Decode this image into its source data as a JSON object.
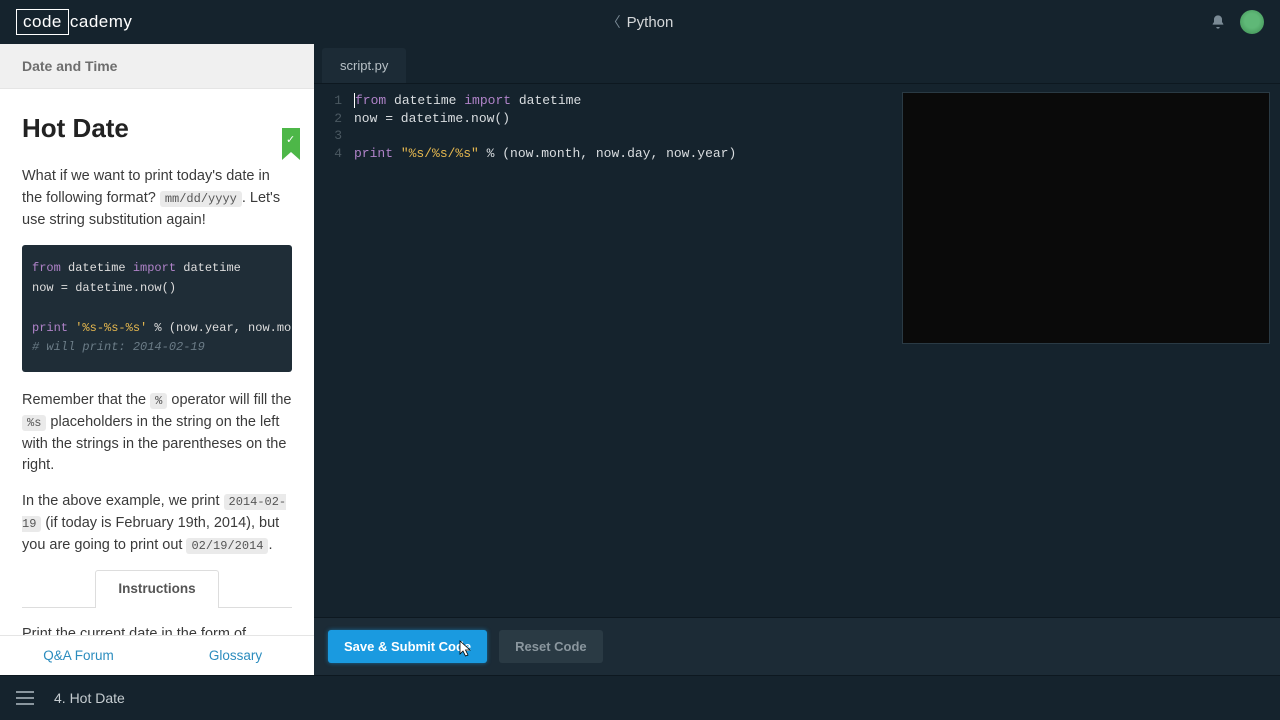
{
  "header": {
    "logo_box": "code",
    "logo_rest": "cademy",
    "course": "Python"
  },
  "lesson": {
    "section": "Date and Time",
    "title": "Hot Date",
    "p1_a": "What if we want to print today's date in the following format? ",
    "p1_code": "mm/dd/yyyy",
    "p1_b": ". Let's use string substitution again!",
    "example_code": {
      "l1_kw1": "from",
      "l1_t1": " datetime ",
      "l1_kw2": "import",
      "l1_t2": " datetime",
      "l2": "now = datetime.now()",
      "l3_kw": "print",
      "l3_str": " '%s-%s-%s'",
      "l3_t": " % (now.year, now.month, no",
      "l4": "# will print: 2014-02-19"
    },
    "p2_a": "Remember that the ",
    "p2_code1": "%",
    "p2_b": " operator will fill the ",
    "p2_code2": "%s",
    "p2_c": " placeholders in the string on the left with the strings in the parentheses on the right.",
    "p3_a": "In the above example, we print ",
    "p3_code1": "2014-02-19",
    "p3_b": " (if today is February 19th, 2014), but you are going to print out ",
    "p3_code2": "02/19/2014",
    "p3_c": ".",
    "instructions_label": "Instructions",
    "instructions_p1": "Print the current date in the form of",
    "footer_qa": "Q&A Forum",
    "footer_glossary": "Glossary"
  },
  "editor": {
    "tab": "script.py",
    "lines": [
      {
        "n": "1",
        "pre_kw": "from",
        "t1": " datetime ",
        "kw2": "import",
        "t2": " datetime"
      },
      {
        "n": "2",
        "plain": "now = datetime.now()"
      },
      {
        "n": "3",
        "plain": ""
      },
      {
        "n": "4",
        "pre_kw": "print",
        "str": " \"%s/%s/%s\"",
        "t2": " % (now.month, now.day, now.year)"
      }
    ]
  },
  "actions": {
    "save": "Save & Submit Code",
    "reset": "Reset Code"
  },
  "bottombar": {
    "title": "4. Hot Date"
  }
}
